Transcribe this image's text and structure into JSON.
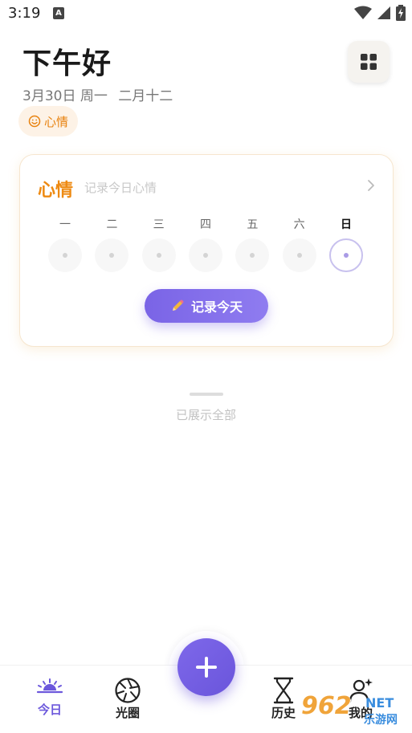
{
  "status_bar": {
    "time": "3:19",
    "notification_glyph": "A"
  },
  "header": {
    "greeting": "下午好",
    "date": "3月30日 周一",
    "lunar_date": "二月十二",
    "mood_chip_label": "心情"
  },
  "mood_card": {
    "title": "心情",
    "subtitle": "记录今日心情",
    "days": [
      {
        "label": "一",
        "today": false
      },
      {
        "label": "二",
        "today": false
      },
      {
        "label": "三",
        "today": false
      },
      {
        "label": "四",
        "today": false
      },
      {
        "label": "五",
        "today": false
      },
      {
        "label": "六",
        "today": false
      },
      {
        "label": "日",
        "today": true
      }
    ],
    "record_button": "记录今天"
  },
  "list_end_text": "已展示全部",
  "bottom_nav": {
    "items": [
      {
        "label": "今日",
        "icon": "sunrise-icon",
        "active": true
      },
      {
        "label": "光圈",
        "icon": "aperture-icon",
        "active": false
      },
      {
        "label": "历史",
        "icon": "hourglass-icon",
        "active": false
      },
      {
        "label": "我的",
        "icon": "user-sparkle-icon",
        "active": false
      }
    ]
  },
  "watermark": {
    "number": "962",
    "suffix": "NET",
    "site": "乐游网"
  },
  "colors": {
    "accent_purple": "#6c58dc",
    "mood_orange": "#ee8a12",
    "chip_bg": "#fdf2e6"
  }
}
